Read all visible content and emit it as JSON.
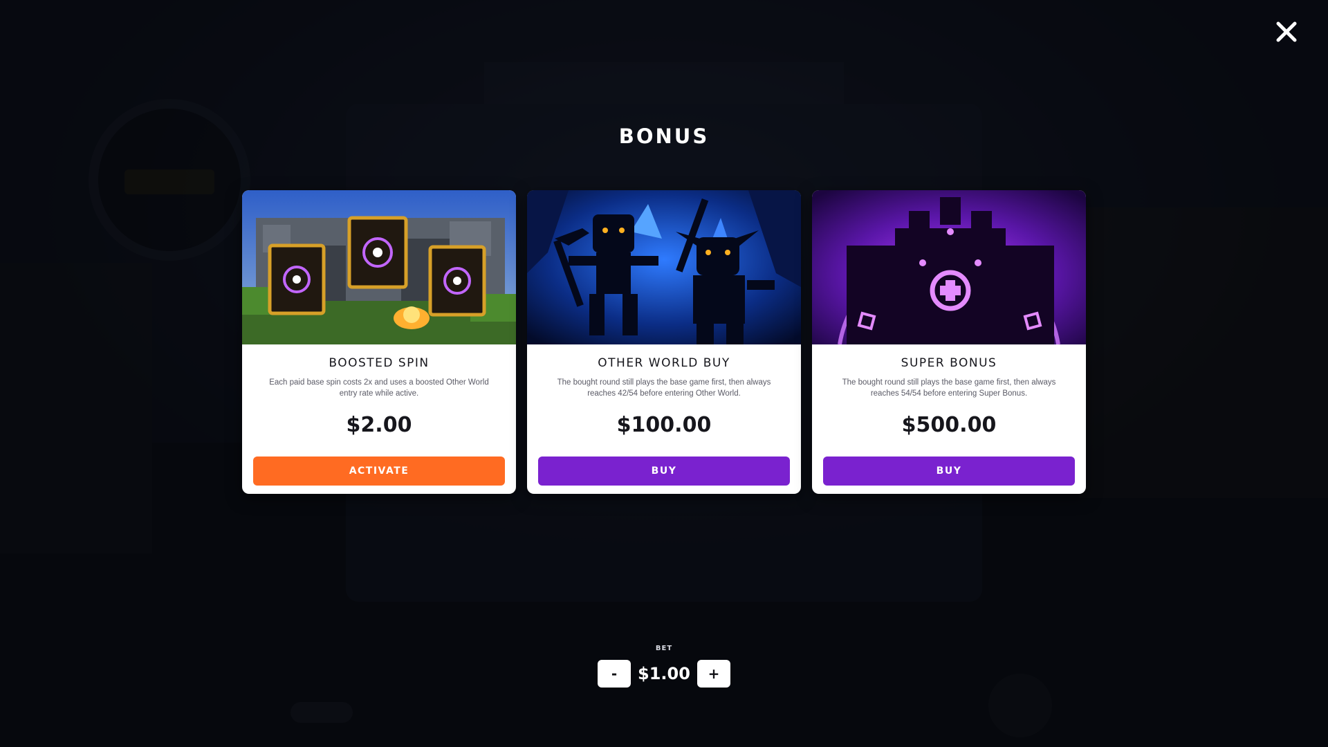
{
  "title": "BONUS",
  "close_icon": "close-icon",
  "accent": {
    "activate_color": "#ff6b22",
    "buy_color": "#7a22cf"
  },
  "cards": [
    {
      "name": "BOOSTED SPIN",
      "description": "Each paid base spin costs 2x and uses a boosted Other World entry rate while active.",
      "price": "$2.00",
      "button_label": "ACTIVATE",
      "art": "eye-rune-books-artwork"
    },
    {
      "name": "OTHER WORLD BUY",
      "description": "The bought round still plays the base game first, then always reaches 42/54 before entering Other World.",
      "price": "$100.00",
      "button_label": "BUY",
      "art": "skeleton-goblin-cave-artwork"
    },
    {
      "name": "SUPER BONUS",
      "description": "The bought round still plays the base game first, then always reaches 54/54 before entering Super Bonus.",
      "price": "$500.00",
      "button_label": "BUY",
      "art": "purple-rune-golem-artwork"
    }
  ],
  "bet": {
    "label": "BET",
    "value": "$1.00",
    "decrease_label": "-",
    "increase_label": "+"
  }
}
